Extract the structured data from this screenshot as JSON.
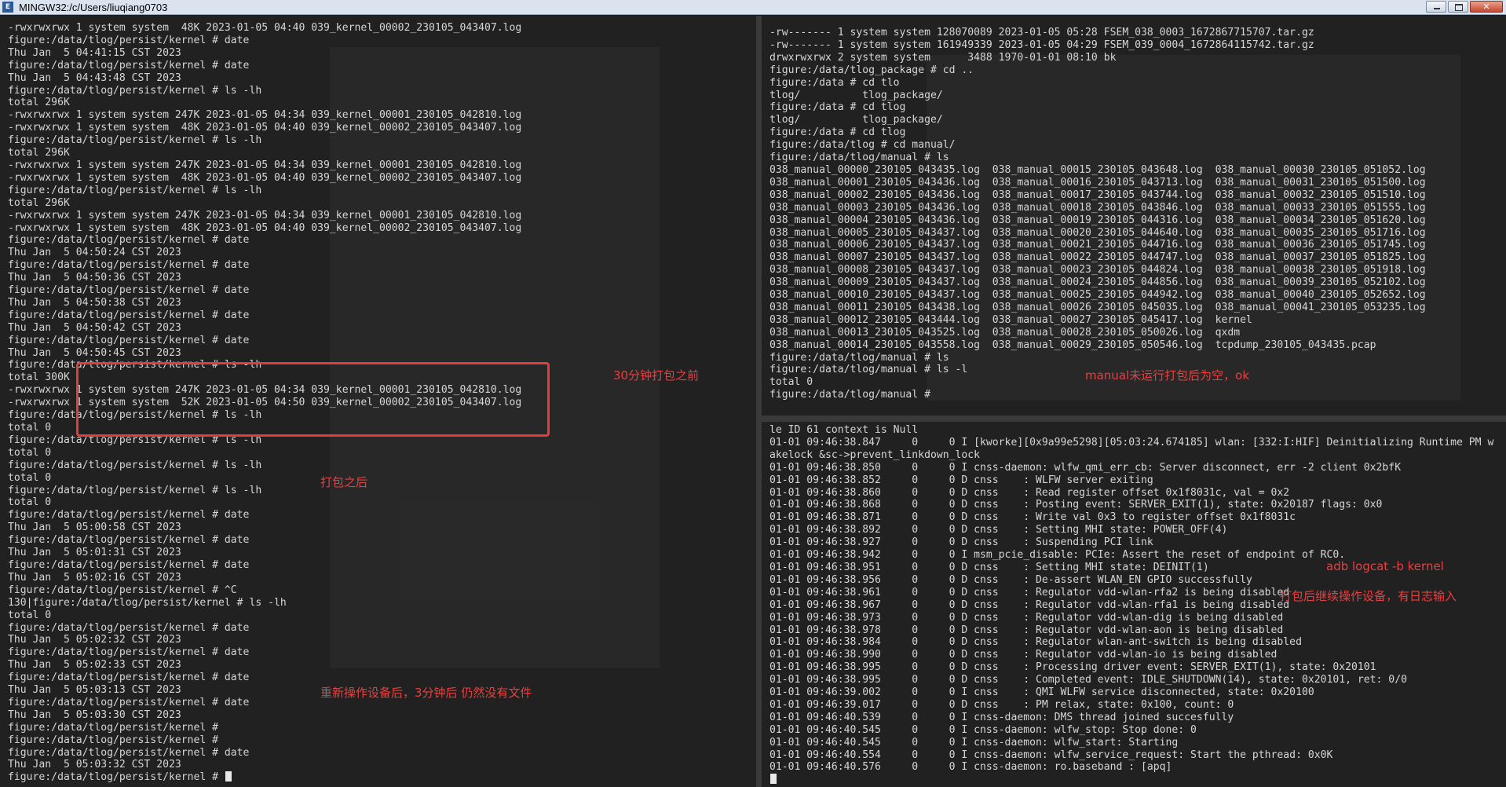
{
  "window": {
    "title": "MINGW32:/c/Users/liuqiang0703",
    "icon": "terminal-app-icon",
    "icon_glyph": "E",
    "controls": {
      "minimize": "minimize-icon",
      "maximize": "maximize-icon",
      "close": "close-icon",
      "close_glyph": "✕"
    }
  },
  "colors": {
    "annotation": "#e64141",
    "terminal_text": "#d6d6d6",
    "terminal_bg": "#212121"
  },
  "panes": {
    "left": {
      "lines": [
        "-rwxrwxrwx 1 system system  48K 2023-01-05 04:40 039_kernel_00002_230105_043407.log",
        "figure:/data/tlog/persist/kernel # date",
        "Thu Jan  5 04:41:15 CST 2023",
        "figure:/data/tlog/persist/kernel # date",
        "Thu Jan  5 04:43:48 CST 2023",
        "figure:/data/tlog/persist/kernel # ls -lh",
        "total 296K",
        "-rwxrwxrwx 1 system system 247K 2023-01-05 04:34 039_kernel_00001_230105_042810.log",
        "-rwxrwxrwx 1 system system  48K 2023-01-05 04:40 039_kernel_00002_230105_043407.log",
        "figure:/data/tlog/persist/kernel # ls -lh",
        "total 296K",
        "-rwxrwxrwx 1 system system 247K 2023-01-05 04:34 039_kernel_00001_230105_042810.log",
        "-rwxrwxrwx 1 system system  48K 2023-01-05 04:40 039_kernel_00002_230105_043407.log",
        "figure:/data/tlog/persist/kernel # ls -lh",
        "total 296K",
        "-rwxrwxrwx 1 system system 247K 2023-01-05 04:34 039_kernel_00001_230105_042810.log",
        "-rwxrwxrwx 1 system system  48K 2023-01-05 04:40 039_kernel_00002_230105_043407.log",
        "figure:/data/tlog/persist/kernel # date",
        "Thu Jan  5 04:50:24 CST 2023",
        "figure:/data/tlog/persist/kernel # date",
        "Thu Jan  5 04:50:36 CST 2023",
        "figure:/data/tlog/persist/kernel # date",
        "Thu Jan  5 04:50:38 CST 2023",
        "figure:/data/tlog/persist/kernel # date",
        "Thu Jan  5 04:50:42 CST 2023",
        "figure:/data/tlog/persist/kernel # date",
        "Thu Jan  5 04:50:45 CST 2023",
        "figure:/data/tlog/persist/kernel # ls -lh",
        "total 300K",
        "-rwxrwxrwx 1 system system 247K 2023-01-05 04:34 039_kernel_00001_230105_042810.log",
        "-rwxrwxrwx 1 system system  52K 2023-01-05 04:50 039_kernel_00002_230105_043407.log",
        "figure:/data/tlog/persist/kernel # ls -lh",
        "total 0",
        "figure:/data/tlog/persist/kernel # ls -lh",
        "total 0",
        "figure:/data/tlog/persist/kernel # ls -lh",
        "total 0",
        "figure:/data/tlog/persist/kernel # ls -lh",
        "total 0",
        "figure:/data/tlog/persist/kernel # date",
        "Thu Jan  5 05:00:58 CST 2023",
        "figure:/data/tlog/persist/kernel # date",
        "Thu Jan  5 05:01:31 CST 2023",
        "figure:/data/tlog/persist/kernel # date",
        "Thu Jan  5 05:02:16 CST 2023",
        "figure:/data/tlog/persist/kernel # ^C",
        "130|figure:/data/tlog/persist/kernel # ls -lh",
        "total 0",
        "figure:/data/tlog/persist/kernel # date",
        "Thu Jan  5 05:02:32 CST 2023",
        "figure:/data/tlog/persist/kernel # date",
        "Thu Jan  5 05:02:33 CST 2023",
        "figure:/data/tlog/persist/kernel # date",
        "Thu Jan  5 05:03:13 CST 2023",
        "figure:/data/tlog/persist/kernel # date",
        "Thu Jan  5 05:03:30 CST 2023",
        "figure:/data/tlog/persist/kernel #",
        "figure:/data/tlog/persist/kernel #",
        "figure:/data/tlog/persist/kernel # date",
        "Thu Jan  5 05:03:32 CST 2023"
      ],
      "prompt": "figure:/data/tlog/persist/kernel # "
    },
    "top_right": {
      "lines": [
        "-rw------- 1 system system 128070089 2023-01-05 05:28 FSEM_038_0003_1672867715707.tar.gz",
        "-rw------- 1 system system 161949339 2023-01-05 04:29 FSEM_039_0004_1672864115742.tar.gz",
        "drwxrwxrwx 2 system system      3488 1970-01-01 08:10 bk",
        "figure:/data/tlog_package # cd ..",
        "figure:/data # cd tlo",
        "tlog/          tlog_package/",
        "figure:/data # cd tlog",
        "tlog/          tlog_package/",
        "figure:/data # cd tlog",
        "figure:/data/tlog # cd manual/",
        "figure:/data/tlog/manual # ls",
        "038_manual_00000_230105_043435.log  038_manual_00015_230105_043648.log  038_manual_00030_230105_051052.log",
        "038_manual_00001_230105_043436.log  038_manual_00016_230105_043713.log  038_manual_00031_230105_051500.log",
        "038_manual_00002_230105_043436.log  038_manual_00017_230105_043744.log  038_manual_00032_230105_051510.log",
        "038_manual_00003_230105_043436.log  038_manual_00018_230105_043846.log  038_manual_00033_230105_051555.log",
        "038_manual_00004_230105_043436.log  038_manual_00019_230105_044316.log  038_manual_00034_230105_051620.log",
        "038_manual_00005_230105_043437.log  038_manual_00020_230105_044640.log  038_manual_00035_230105_051716.log",
        "038_manual_00006_230105_043437.log  038_manual_00021_230105_044716.log  038_manual_00036_230105_051745.log",
        "038_manual_00007_230105_043437.log  038_manual_00022_230105_044747.log  038_manual_00037_230105_051825.log",
        "038_manual_00008_230105_043437.log  038_manual_00023_230105_044824.log  038_manual_00038_230105_051918.log",
        "038_manual_00009_230105_043437.log  038_manual_00024_230105_044856.log  038_manual_00039_230105_052102.log",
        "038_manual_00010_230105_043437.log  038_manual_00025_230105_044942.log  038_manual_00040_230105_052652.log",
        "038_manual_00011_230105_043438.log  038_manual_00026_230105_045035.log  038_manual_00041_230105_053235.log",
        "038_manual_00012_230105_043444.log  038_manual_00027_230105_045417.log  kernel",
        "038_manual_00013_230105_043525.log  038_manual_00028_230105_050026.log  qxdm",
        "038_manual_00014_230105_043558.log  038_manual_00029_230105_050546.log  tcpdump_230105_043435.pcap",
        "figure:/data/tlog/manual # ls",
        "figure:/data/tlog/manual # ls -l",
        "total 0",
        "figure:/data/tlog/manual #"
      ]
    },
    "bottom_right": {
      "lines": [
        "le ID 61 context is Null",
        "01-01 09:46:38.847     0     0 I [kworke][0x9a99e5298][05:03:24.674185] wlan: [332:I:HIF] Deinitializing Runtime PM w",
        "akelock &sc->prevent_linkdown_lock",
        "01-01 09:46:38.850     0     0 I cnss-daemon: wlfw_qmi_err_cb: Server disconnect, err -2 client 0x2bfK",
        "01-01 09:46:38.852     0     0 D cnss    : WLFW server exiting",
        "01-01 09:46:38.860     0     0 D cnss    : Read register offset 0x1f8031c, val = 0x2",
        "01-01 09:46:38.868     0     0 D cnss    : Posting event: SERVER_EXIT(1), state: 0x20187 flags: 0x0",
        "01-01 09:46:38.871     0     0 D cnss    : Write val 0x3 to register offset 0x1f8031c",
        "01-01 09:46:38.892     0     0 D cnss    : Setting MHI state: POWER_OFF(4)",
        "01-01 09:46:38.927     0     0 D cnss    : Suspending PCI link",
        "01-01 09:46:38.942     0     0 I msm_pcie_disable: PCIe: Assert the reset of endpoint of RC0.",
        "01-01 09:46:38.951     0     0 D cnss    : Setting MHI state: DEINIT(1)",
        "01-01 09:46:38.956     0     0 D cnss    : De-assert WLAN_EN GPIO successfully",
        "01-01 09:46:38.961     0     0 D cnss    : Regulator vdd-wlan-rfa2 is being disabled",
        "01-01 09:46:38.967     0     0 D cnss    : Regulator vdd-wlan-rfa1 is being disabled",
        "01-01 09:46:38.973     0     0 D cnss    : Regulator vdd-wlan-dig is being disabled",
        "01-01 09:46:38.978     0     0 D cnss    : Regulator vdd-wlan-aon is being disabled",
        "01-01 09:46:38.984     0     0 D cnss    : Regulator wlan-ant-switch is being disabled",
        "01-01 09:46:38.990     0     0 D cnss    : Regulator vdd-wlan-io is being disabled",
        "01-01 09:46:38.995     0     0 D cnss    : Processing driver event: SERVER_EXIT(1), state: 0x20101",
        "01-01 09:46:38.995     0     0 D cnss    : Completed event: IDLE_SHUTDOWN(14), state: 0x20101, ret: 0/0",
        "01-01 09:46:39.002     0     0 I cnss    : QMI WLFW service disconnected, state: 0x20100",
        "01-01 09:46:39.017     0     0 D cnss    : PM relax, state: 0x100, count: 0",
        "01-01 09:46:40.539     0     0 I cnss-daemon: DMS thread joined succesfully",
        "01-01 09:46:40.545     0     0 I cnss-daemon: wlfw_stop: Stop done: 0",
        "01-01 09:46:40.545     0     0 I cnss-daemon: wlfw_start: Starting",
        "01-01 09:46:40.554     0     0 I cnss-daemon: wlfw_service_request: Start the pthread: 0x0K",
        "01-01 09:46:40.576     0     0 I cnss-daemon: ro.baseband : [apq]"
      ]
    }
  },
  "annotations": {
    "before_30min": "30分钟打包之前",
    "after_pack": "打包之后",
    "after_reoperate": "重新操作设备后，3分钟后 仍然没有文件",
    "manual_empty": "manual未运行打包后为空，ok",
    "adb_logcat": "adb logcat -b kernel",
    "continue_operating": "打包后继续操作设备，有日志输入"
  }
}
